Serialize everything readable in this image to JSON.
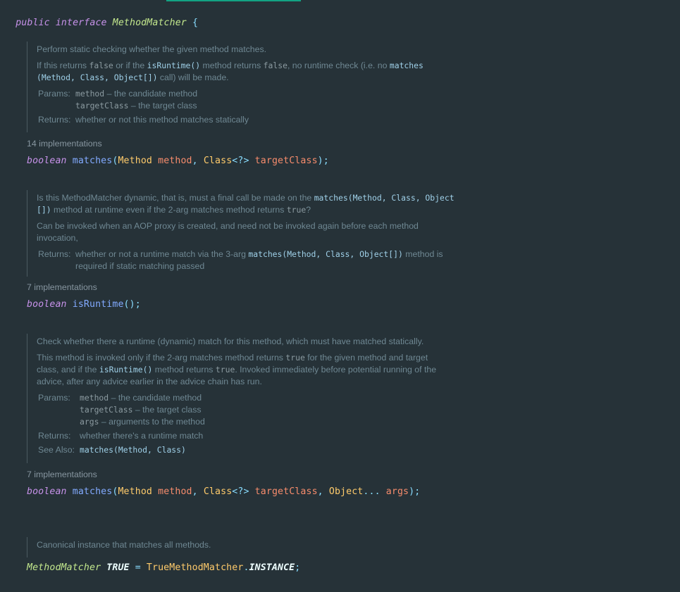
{
  "header": {
    "public_kw": "public",
    "interface_kw": "interface",
    "name": "MethodMatcher",
    "brace": "{"
  },
  "doc1": {
    "summary": "Perform static checking whether the given method matches.",
    "detail_1": "If this returns",
    "detail_false_1": "false",
    "detail_2": "or if the",
    "detail_isRuntime": "isRuntime()",
    "detail_3": "method returns",
    "detail_false_2": "false",
    "detail_4": ", no runtime check (i.e. no",
    "detail_matches": "matches",
    "detail_sig": "(Method, Class, Object[])",
    "detail_5": "call) will be made.",
    "params_label": "Params:",
    "p1_name": "method",
    "p1_desc": "– the candidate method",
    "p2_name": "targetClass",
    "p2_desc": "– the target class",
    "returns_label": "Returns:",
    "returns_desc": "whether or not this method matches statically"
  },
  "impl1": "14 implementations",
  "sig1": {
    "ret": "boolean",
    "name": "matches",
    "open": "(",
    "t1": "Method",
    "p1": "method",
    "comma1": ",",
    "t2": "Class",
    "generic": "<?>",
    "p2": "targetClass",
    "close": ");"
  },
  "doc2": {
    "summary_1": "Is this MethodMatcher dynamic, that is, must a final call be made on the",
    "summary_link_1": "matches(Method, Class, Object",
    "summary_link_2": "[])",
    "summary_2": "method at runtime even if the 2-arg matches method returns",
    "summary_true": "true",
    "summary_3": "?",
    "detail": "Can be invoked when an AOP proxy is created, and need not be invoked again before each method invocation,",
    "returns_label": "Returns:",
    "returns_1": "whether or not a runtime match via the 3-arg",
    "returns_link": "matches(Method, Class, Object[])",
    "returns_2": "method is",
    "returns_3": "required if static matching passed"
  },
  "impl2": "7 implementations",
  "sig2": {
    "ret": "boolean",
    "name": "isRuntime",
    "close": "();"
  },
  "doc3": {
    "summary": "Check whether there a runtime (dynamic) match for this method, which must have matched statically.",
    "d_1": "This method is invoked only if the 2-arg matches method returns",
    "d_true_1": "true",
    "d_2": "for the given method and target",
    "d_3": "class, and if the",
    "d_isRuntime": "isRuntime()",
    "d_4": "method returns",
    "d_true_2": "true",
    "d_5": ". Invoked immediately before potential running of the",
    "d_6": "advice, after any advice earlier in the advice chain has run.",
    "params_label": "Params:",
    "p1_name": "method",
    "p1_desc": "– the candidate method",
    "p2_name": "targetClass",
    "p2_desc": "– the target class",
    "p3_name": "args",
    "p3_desc": "– arguments to the method",
    "returns_label": "Returns:",
    "returns_desc": "whether there's a runtime match",
    "see_label": "See Also:",
    "see_link": "matches(Method, Class)"
  },
  "impl3": "7 implementations",
  "sig3": {
    "ret": "boolean",
    "name": "matches",
    "open": "(",
    "t1": "Method",
    "p1": "method",
    "comma1": ",",
    "t2": "Class",
    "generic": "<?>",
    "p2": "targetClass",
    "comma2": ",",
    "t3": "Object",
    "varargs": "...",
    "p3": "args",
    "close": ");"
  },
  "doc4": {
    "summary": "Canonical instance that matches all methods."
  },
  "field": {
    "type": "MethodMatcher",
    "name": "TRUE",
    "eq": "=",
    "owner": "TrueMethodMatcher",
    "dot": ".",
    "member": "INSTANCE",
    "semi": ";"
  }
}
